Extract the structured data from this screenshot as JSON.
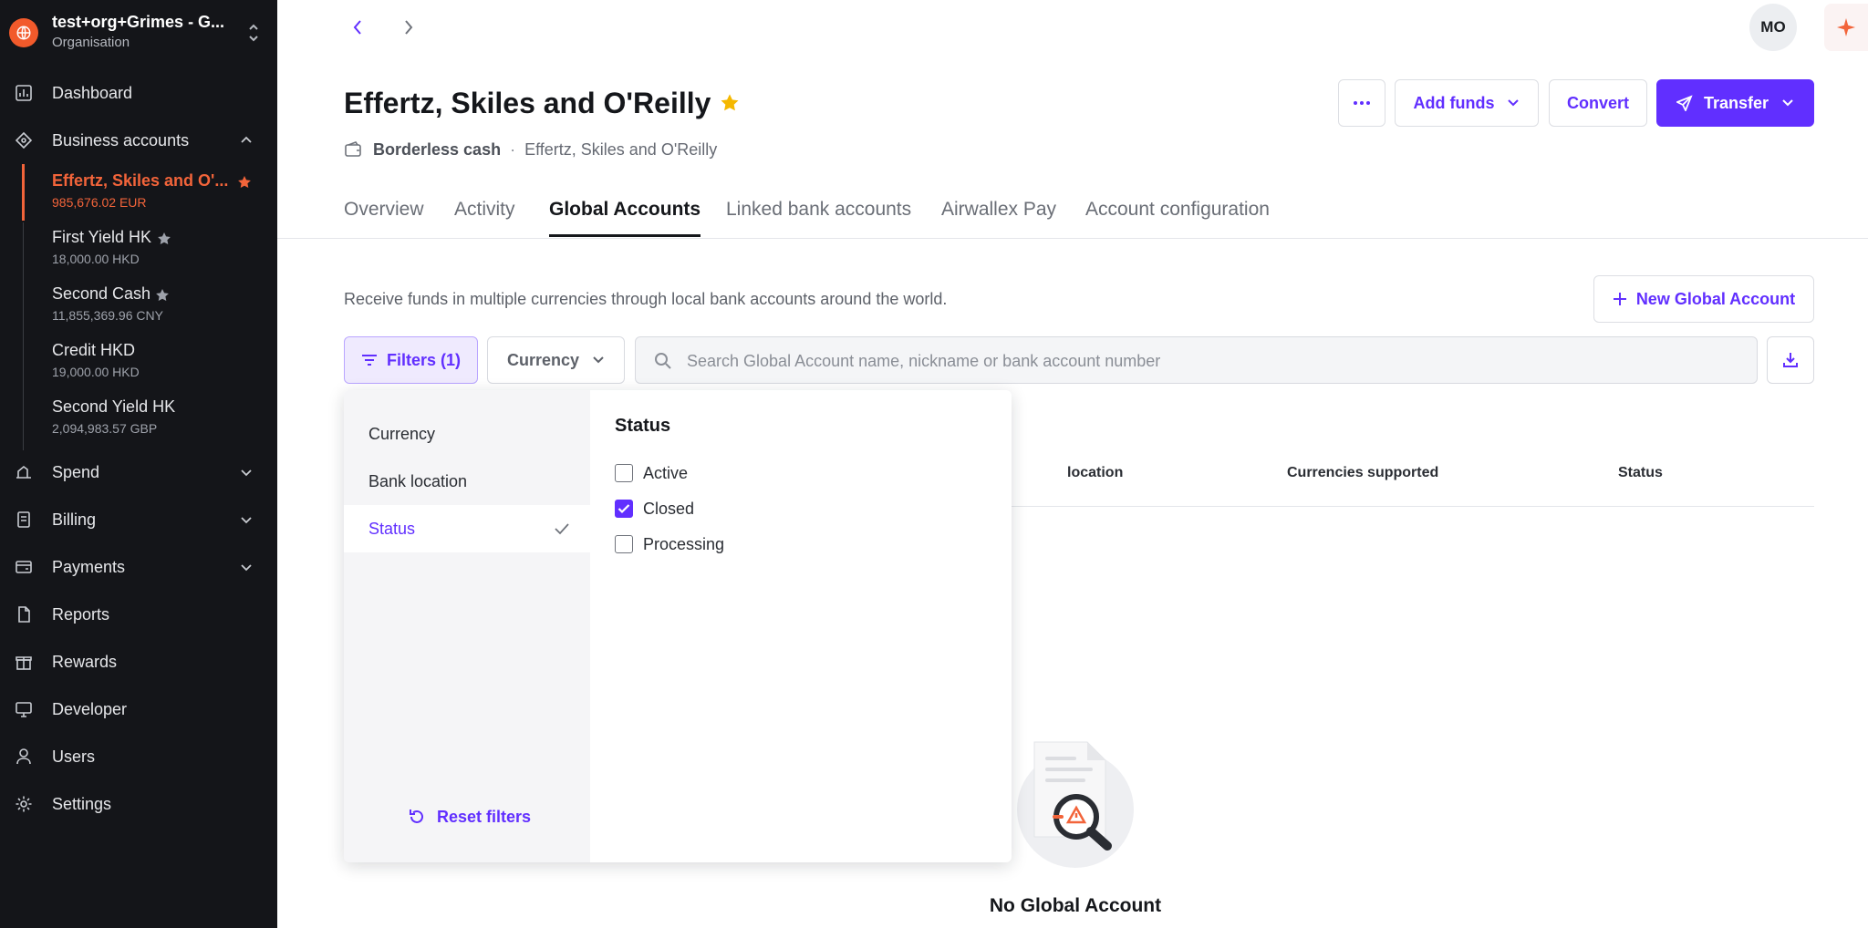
{
  "org": {
    "name": "test+org+Grimes - G...",
    "subtitle": "Organisation"
  },
  "nav": {
    "dashboard": "Dashboard",
    "business_accounts": "Business accounts",
    "spend": "Spend",
    "billing": "Billing",
    "payments": "Payments",
    "reports": "Reports",
    "rewards": "Rewards",
    "developer": "Developer",
    "users": "Users",
    "settings": "Settings"
  },
  "accounts": [
    {
      "name": "Effertz, Skiles and O'...",
      "balance": "985,676.02 EUR",
      "starred": true,
      "active": true
    },
    {
      "name": "First Yield HK",
      "balance": "18,000.00 HKD",
      "starred": true
    },
    {
      "name": "Second Cash",
      "balance": "11,855,369.96 CNY",
      "starred": true
    },
    {
      "name": "Credit HKD",
      "balance": "19,000.00 HKD",
      "starred": false
    },
    {
      "name": "Second Yield HK",
      "balance": "2,094,983.57 GBP",
      "starred": false
    }
  ],
  "header": {
    "avatar_initials": "MO",
    "title": "Effertz, Skiles and O'Reilly",
    "account_type": "Borderless cash",
    "account_name": "Effertz, Skiles and O'Reilly",
    "actions": {
      "add_funds": "Add funds",
      "convert": "Convert",
      "transfer": "Transfer"
    }
  },
  "tabs": [
    {
      "label": "Overview"
    },
    {
      "label": "Activity"
    },
    {
      "label": "Global Accounts",
      "active": true
    },
    {
      "label": "Linked bank accounts"
    },
    {
      "label": "Airwallex Pay"
    },
    {
      "label": "Account configuration"
    }
  ],
  "content": {
    "description": "Receive funds in multiple currencies through local bank accounts around the world.",
    "new_account_button": "New Global Account",
    "filters_button": "Filters (1)",
    "currency_button": "Currency",
    "search_placeholder": "Search Global Account name, nickname or bank account number",
    "columns": {
      "location": "location",
      "currencies": "Currencies supported",
      "status": "Status"
    },
    "empty_title": "No Global Account"
  },
  "filter_panel": {
    "categories": [
      "Currency",
      "Bank location",
      "Status"
    ],
    "active_category": "Status",
    "reset_label": "Reset filters",
    "heading": "Status",
    "options": [
      {
        "label": "Active",
        "checked": false
      },
      {
        "label": "Closed",
        "checked": true
      },
      {
        "label": "Processing",
        "checked": false
      }
    ]
  },
  "colors": {
    "accent": "#612FFF",
    "sidebar_bg": "#141519",
    "active_account": "#F2643A",
    "star_gold": "#F5B800"
  }
}
